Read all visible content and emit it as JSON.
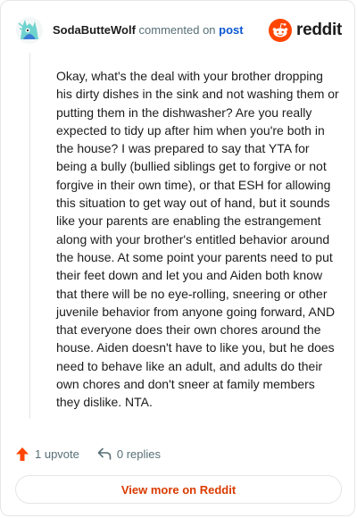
{
  "header": {
    "username": "SodaButteWolf",
    "commented_text": "commented on",
    "post_link": "post",
    "brand_word": "reddit",
    "icons": {
      "avatar": "wolf-avatar-icon",
      "brand": "reddit-snoo-icon"
    },
    "colors": {
      "brand": "#ff4500",
      "link": "#0b57d0"
    }
  },
  "comment": {
    "body": "Okay, what's the deal with your brother dropping his dirty dishes in the sink and not washing them or putting them in the dishwasher? Are you really expected to tidy up after him when you're both in the house? I was prepared to say that YTA for being a bully (bullied siblings get to forgive or not forgive in their own time), or that ESH for allowing this situation to get way out of hand, but it sounds like your parents are enabling the estrangement along with your brother's entitled behavior around the house. At some point your parents need to put their feet down and let you and Aiden both know that there will be no eye-rolling, sneering or other juvenile behavior from anyone going forward, AND that everyone does their own chores around the house. Aiden doesn't have to like you, but he does need to behave like an adult, and adults do their own chores and don't sneer at family members they dislike. NTA."
  },
  "actions": {
    "upvote_label": "1 upvote",
    "replies_label": "0 replies",
    "icons": {
      "upvote": "upvote-arrow-icon",
      "reply": "reply-arrow-icon"
    },
    "colors": {
      "upvote": "#ff4500"
    }
  },
  "footer": {
    "view_more_label": "View more on Reddit",
    "colors": {
      "view_more": "#d93a00"
    }
  }
}
